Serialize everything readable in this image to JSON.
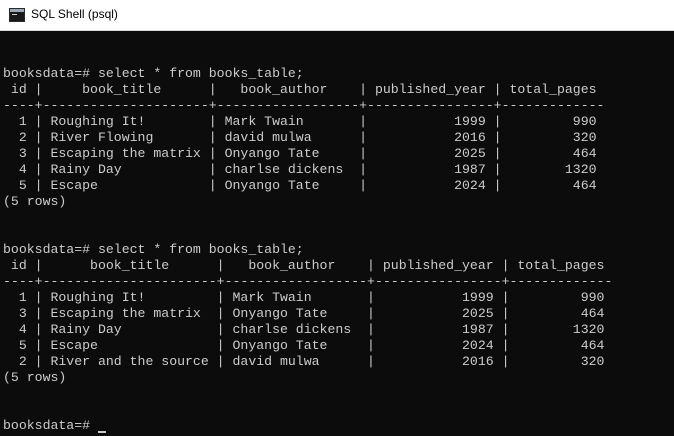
{
  "window": {
    "title": "SQL Shell (psql)",
    "app_icon": "console-window-icon"
  },
  "colors": {
    "background": "#0c0c0c",
    "text": "#cccccc",
    "titlebar": "#ffffff"
  },
  "console": {
    "lines": [
      "",
      "",
      "booksdata=# select * from books_table;",
      " id |     book_title      |   book_author    | published_year | total_pages",
      "----+---------------------+------------------+----------------+-------------",
      "  1 | Roughing It!        | Mark Twain       |           1999 |         990",
      "  2 | River Flowing       | david mulwa      |           2016 |         320",
      "  3 | Escaping the matrix | Onyango Tate     |           2025 |         464",
      "  4 | Rainy Day           | charlse dickens  |           1987 |        1320",
      "  5 | Escape              | Onyango Tate     |           2024 |         464",
      "(5 rows)",
      "",
      "",
      "booksdata=# select * from books_table;",
      " id |      book_title      |   book_author    | published_year | total_pages",
      "----+----------------------+------------------+----------------+-------------",
      "  1 | Roughing It!         | Mark Twain       |           1999 |         990",
      "  3 | Escaping the matrix  | Onyango Tate     |           2025 |         464",
      "  4 | Rainy Day            | charlse dickens  |           1987 |        1320",
      "  5 | Escape               | Onyango Tate     |           2024 |         464",
      "  2 | River and the source | david mulwa      |           2016 |         320",
      "(5 rows)",
      "",
      "",
      "booksdata=# "
    ]
  }
}
